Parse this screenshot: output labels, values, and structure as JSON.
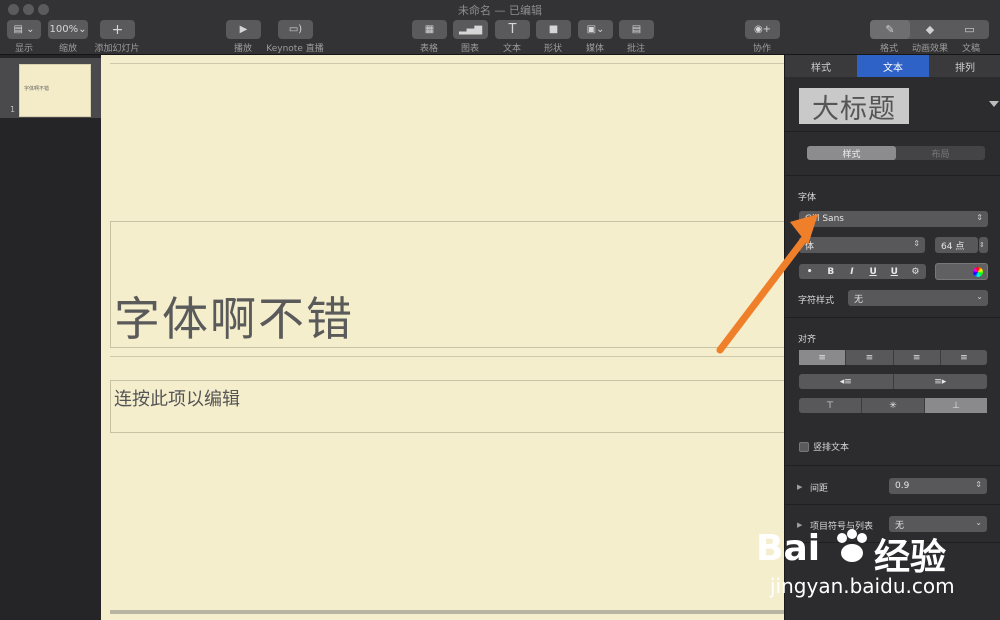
{
  "window": {
    "title": "未命名 — 已编辑"
  },
  "toolbar": {
    "view": {
      "label": "显示"
    },
    "zoom": {
      "value": "100%",
      "label": "缩放"
    },
    "add_slide": {
      "icon": "plus-icon",
      "label": "添加幻灯片"
    },
    "play": {
      "icon": "play-icon",
      "label": "播放"
    },
    "keynote_live": {
      "icon": "broadcast-icon",
      "label": "Keynote 直播"
    },
    "table": {
      "icon": "table-icon",
      "label": "表格"
    },
    "chart": {
      "icon": "chart-icon",
      "label": "图表"
    },
    "text": {
      "icon": "text-icon",
      "label": "文本"
    },
    "shape": {
      "icon": "shape-icon",
      "label": "形状"
    },
    "media": {
      "icon": "media-icon",
      "label": "媒体"
    },
    "comment": {
      "icon": "comment-icon",
      "label": "批注"
    },
    "collaborate": {
      "icon": "collaborate-icon",
      "label": "协作"
    },
    "format": {
      "icon": "format-brush-icon",
      "label": "格式"
    },
    "animate": {
      "icon": "animate-icon",
      "label": "动画效果"
    },
    "document": {
      "icon": "document-icon",
      "label": "文稿"
    }
  },
  "navigator": {
    "slide_number": "1",
    "thumb_text": "字体啊不错"
  },
  "slide": {
    "title_text": "字体啊不错",
    "body_placeholder": "连按此项以编辑"
  },
  "inspector": {
    "tabs": [
      "样式",
      "文本",
      "排列"
    ],
    "active_tab": "文本",
    "style_preview": "大标题",
    "style_segment": [
      "样式",
      "布局"
    ],
    "font_section": "字体",
    "font_family": "Gill Sans",
    "font_style": "体",
    "font_size": "64 点",
    "format_buttons": [
      "•",
      "B",
      "I",
      "U",
      "U",
      "⚙"
    ],
    "char_style_label": "字符样式",
    "char_style_value": "无",
    "align_section": "对齐",
    "vertical_text_label": "竖排文本",
    "spacing_label": "间距",
    "spacing_value": "0.9",
    "bullets_label": "项目符号与列表",
    "bullets_value": "无"
  },
  "colors": {
    "accent": "#2f62c7",
    "annotation_arrow": "#f07f2a",
    "slide_bg": "#f5eecd"
  },
  "watermark": {
    "main": "Bai",
    "after": "经验",
    "sub": "jingyan.baidu.com"
  }
}
